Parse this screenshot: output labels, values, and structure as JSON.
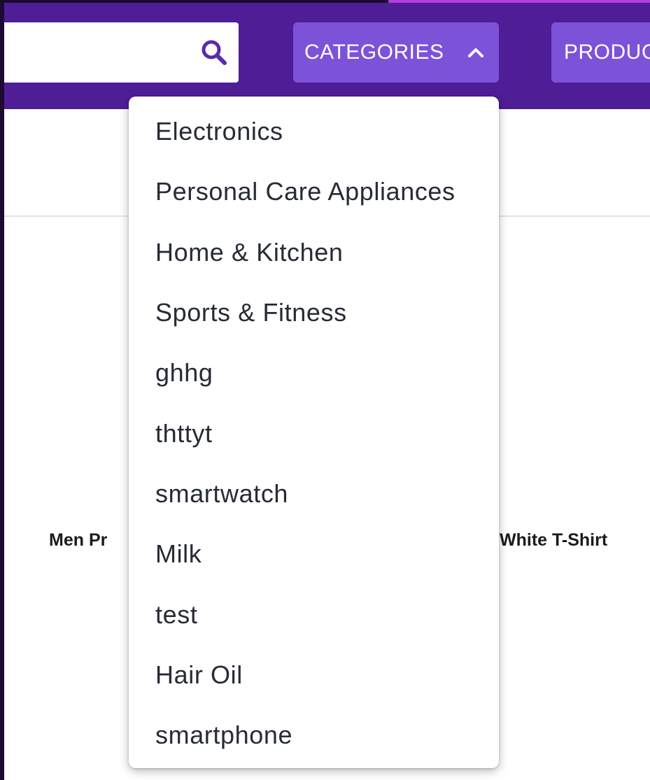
{
  "header": {
    "search": {
      "placeholder": ""
    },
    "categories_label": "CATEGORIES",
    "products_label": "PRODUC"
  },
  "colors": {
    "navbar": "#4f1d96",
    "nav_button": "#7c52d9",
    "search_icon": "#5b2aa8",
    "accent_top": "#b23fe0"
  },
  "icons": {
    "search": "search-icon",
    "categories_toggle": "chevron-up-icon"
  },
  "products": [
    {
      "name": "Men Pr"
    },
    {
      "name": "White T-Shirt"
    }
  ],
  "categories_menu": {
    "items": [
      "Electronics",
      "Personal Care Appliances",
      "Home & Kitchen",
      "Sports & Fitness",
      "ghhg",
      "thttyt",
      "smartwatch",
      "Milk",
      "test",
      "Hair Oil",
      "smartphone"
    ]
  }
}
